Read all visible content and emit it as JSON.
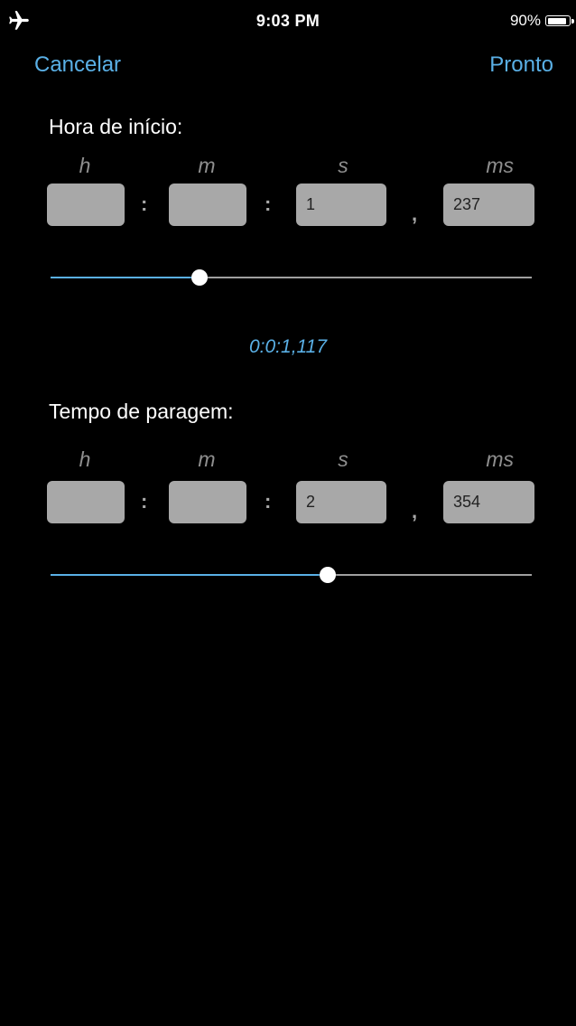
{
  "status_bar": {
    "airplane_icon": "airplane-icon",
    "time": "9:03 PM",
    "battery_percent": "90%",
    "battery_level": 0.9
  },
  "nav": {
    "cancel_label": "Cancelar",
    "done_label": "Pronto"
  },
  "units": {
    "h": "h",
    "m": "m",
    "s": "s",
    "ms": "ms"
  },
  "separators": {
    "colon": ":",
    "comma": ","
  },
  "start": {
    "title": "Hora de início:",
    "hours": "",
    "minutes": "",
    "seconds": "1",
    "milliseconds": "237",
    "slider_value": 0.31
  },
  "summary_text": "0:0:1,117",
  "stop": {
    "title": "Tempo de paragem:",
    "hours": "",
    "minutes": "",
    "seconds": "2",
    "milliseconds": "354",
    "slider_value": 0.576
  },
  "colors": {
    "accent": "#5ab0e6",
    "background": "#000000",
    "field": "#a8a8a8"
  }
}
